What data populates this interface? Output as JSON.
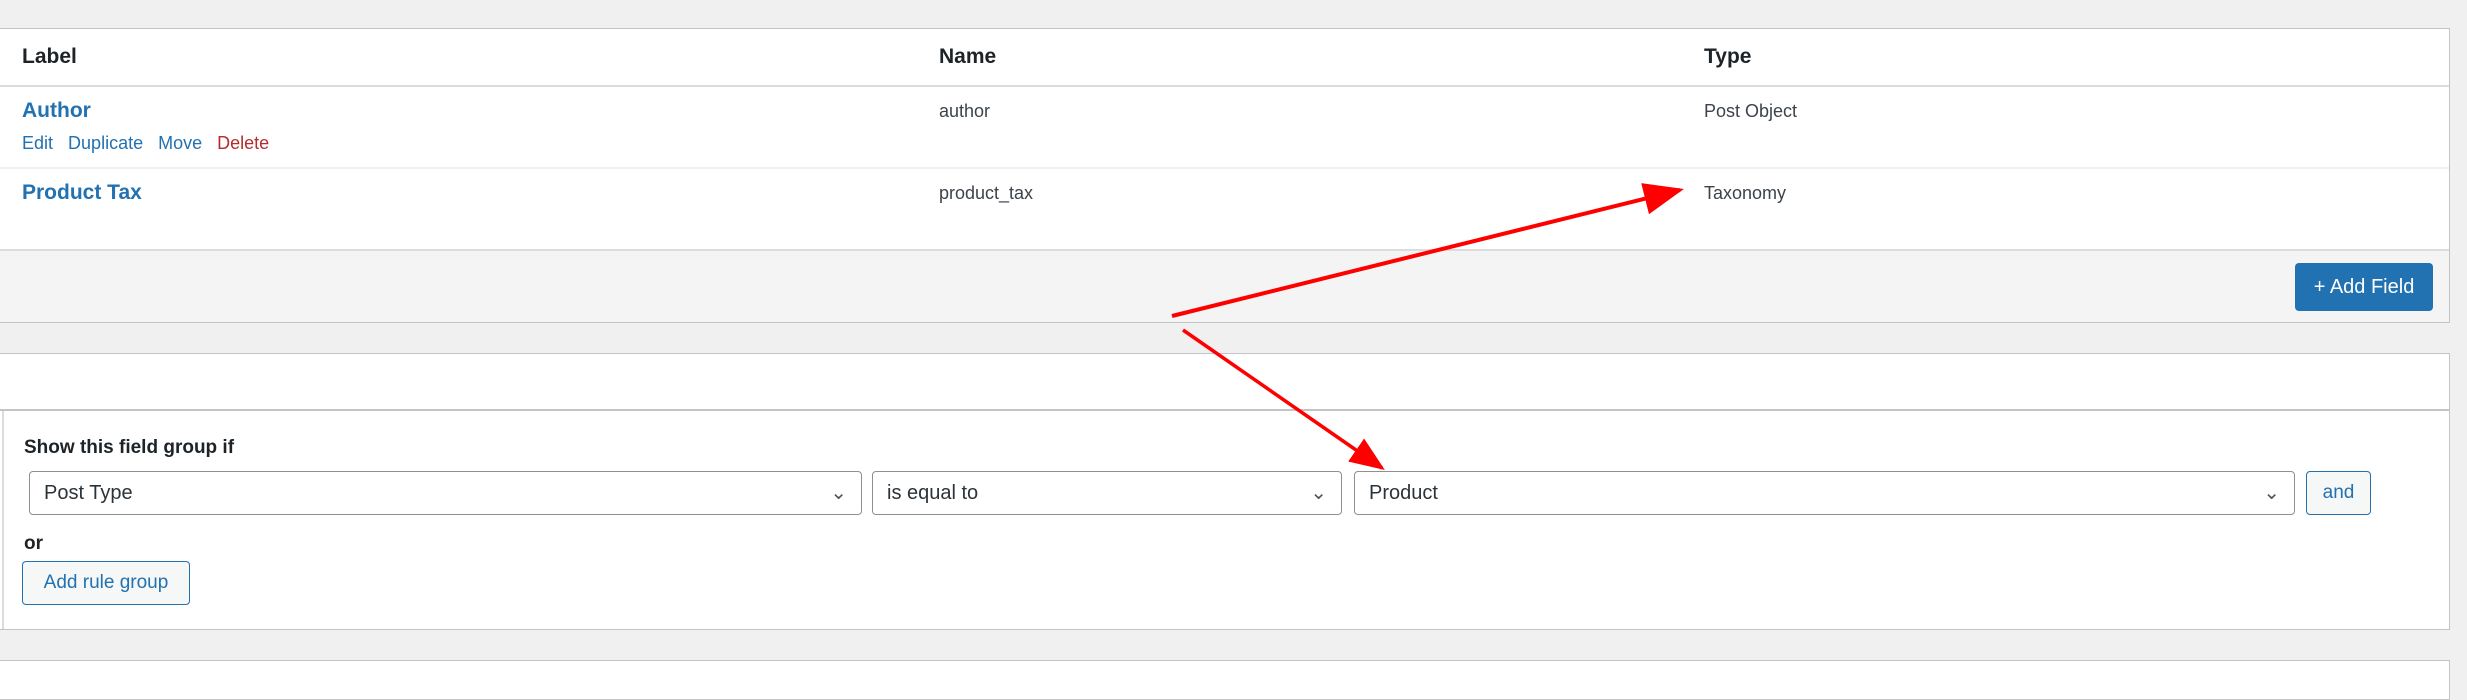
{
  "fields_table": {
    "headers": {
      "label": "Label",
      "name": "Name",
      "type": "Type"
    },
    "rows": [
      {
        "label": "Author",
        "name": "author",
        "type": "Post Object",
        "actions": {
          "edit": "Edit",
          "duplicate": "Duplicate",
          "move": "Move",
          "delete": "Delete"
        }
      },
      {
        "label": "Product Tax",
        "name": "product_tax",
        "type": "Taxonomy"
      }
    ],
    "add_field_label": "+ Add Field"
  },
  "location_rules": {
    "heading": "Show this field group if",
    "param": "Post Type",
    "operator": "is equal to",
    "value": "Product",
    "and_label": "and",
    "or_label": "or",
    "add_rule_group_label": "Add rule group"
  },
  "colors": {
    "accent": "#2271b1",
    "delete": "#b32d2e",
    "annotation": "#ff0000"
  }
}
